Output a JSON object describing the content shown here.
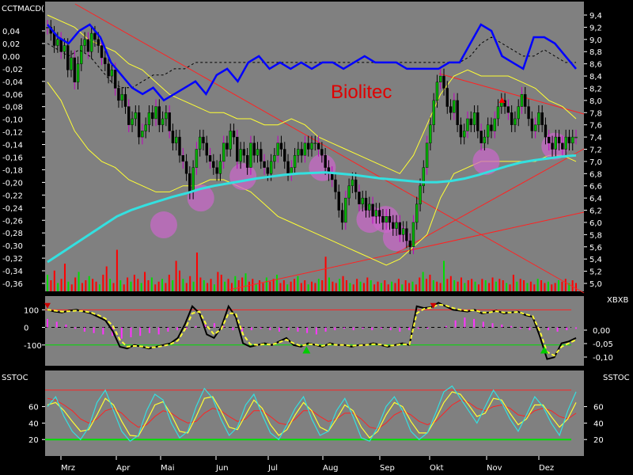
{
  "colors": {
    "background": "#000000",
    "panel": "#808080",
    "up_candle": "#00b000",
    "down_candle": "#000000",
    "wick_alt": "#c000c0",
    "blue_line": "#0000ff",
    "cyan_ma": "#33e0e0",
    "yellow": "#ffff33",
    "trendline": "#ff2222",
    "hist_magenta": "#ff33ff",
    "green_line": "#00e000",
    "vol_red": "#ff0000",
    "vol_green": "#00dd00"
  },
  "chart_data": [
    {
      "panel": "price",
      "type": "candlestick",
      "title": "Biolitec",
      "indicator_label": "CCTMACD(",
      "xlabel": "",
      "ylabel": "",
      "x_ticks": [
        "Mrz",
        "Apr",
        "Mai",
        "Jun",
        "Jul",
        "Aug",
        "Sep",
        "Okt",
        "Nov",
        "Dez"
      ],
      "y_right_range": [
        5.0,
        9.4
      ],
      "y_right_ticks": [
        "9,4",
        "9,2",
        "9,0",
        "8,8",
        "8,6",
        "8,4",
        "8,2",
        "8,0",
        "7,8",
        "7,6",
        "7,4",
        "7,2",
        "7,0",
        "6,8",
        "6,6",
        "6,4",
        "6,2",
        "6,0",
        "5,8",
        "5,6",
        "5,4",
        "5,2",
        "5,0"
      ],
      "y_left_range": [
        -0.36,
        0.04
      ],
      "y_left_ticks": [
        "0,04",
        "0,02",
        "0,00",
        "-0,02",
        "-0,04",
        "-0,06",
        "-0,08",
        "-0,10",
        "-0,12",
        "-0,14",
        "-0,16",
        "-0,18",
        "-0,20",
        "-0,22",
        "-0,24",
        "-0,26",
        "-0,28",
        "-0,30",
        "-0,32",
        "-0,34",
        "-0,36"
      ],
      "close": [
        9.2,
        9.1,
        8.9,
        9.0,
        8.8,
        8.9,
        8.5,
        8.7,
        8.3,
        8.6,
        8.9,
        9.0,
        8.8,
        9.1,
        9.0,
        8.9,
        8.7,
        8.6,
        8.4,
        8.5,
        8.2,
        8.0,
        8.1,
        7.9,
        7.6,
        7.7,
        7.8,
        7.4,
        7.5,
        7.6,
        7.8,
        7.7,
        7.9,
        7.6,
        7.7,
        7.8,
        7.5,
        7.3,
        7.4,
        7.1,
        7.0,
        6.8,
        6.5,
        6.9,
        7.2,
        7.4,
        7.3,
        7.1,
        7.0,
        6.9,
        6.8,
        7.0,
        7.3,
        7.2,
        7.5,
        7.4,
        7.0,
        7.2,
        7.1,
        6.9,
        7.3,
        7.1,
        7.2,
        7.0,
        6.9,
        6.8,
        7.0,
        7.1,
        7.3,
        7.2,
        7.0,
        6.8,
        6.9,
        7.1,
        7.2,
        7.1,
        7.3,
        7.2,
        7.3,
        7.3,
        7.2,
        7.1,
        6.9,
        6.8,
        6.7,
        6.5,
        6.2,
        6.0,
        6.4,
        6.6,
        6.7,
        6.5,
        6.3,
        6.4,
        6.2,
        6.3,
        6.1,
        6.2,
        6.1,
        6.0,
        6.1,
        6.0,
        5.9,
        6.0,
        5.8,
        5.9,
        5.7,
        5.6,
        6.0,
        6.3,
        6.6,
        6.9,
        7.3,
        7.6,
        8.0,
        8.3,
        8.4,
        8.2,
        7.9,
        7.8,
        8.0,
        7.6,
        7.4,
        7.5,
        7.7,
        7.6,
        7.8,
        7.5,
        7.3,
        7.4,
        7.6,
        7.5,
        7.7,
        7.9,
        8.0,
        7.9,
        7.8,
        7.6,
        7.7,
        7.9,
        8.1,
        7.9,
        7.7,
        7.5,
        7.6,
        7.8,
        7.6,
        7.4,
        7.3,
        7.2,
        7.4,
        7.3,
        7.2,
        7.4,
        7.3,
        7.4,
        7.4
      ],
      "volume": [
        12,
        8,
        15,
        6,
        9,
        20,
        7,
        5,
        10,
        14,
        6,
        8,
        11,
        9,
        7,
        5,
        12,
        18,
        9,
        6,
        30,
        8,
        5,
        10,
        7,
        12,
        9,
        6,
        14,
        8,
        10,
        5,
        7,
        9,
        6,
        12,
        8,
        22,
        15,
        9,
        6,
        11,
        7,
        28,
        10,
        8,
        6,
        9,
        5,
        14,
        12,
        7,
        9,
        6,
        11,
        8,
        10,
        13,
        7,
        9,
        5,
        8,
        6,
        10,
        7,
        9,
        12,
        6,
        8,
        5,
        7,
        9,
        11,
        6,
        8,
        5,
        7,
        6,
        9,
        8,
        25,
        10,
        7,
        6,
        9,
        11,
        8,
        6,
        5,
        9,
        7,
        6,
        10,
        8,
        5,
        7,
        6,
        8,
        5,
        7,
        6,
        9,
        5,
        8,
        6,
        7,
        5,
        10,
        14,
        9,
        12,
        8,
        7,
        6,
        22,
        9,
        11,
        8,
        7,
        10,
        6,
        8,
        9,
        7,
        5,
        9,
        8,
        6,
        10,
        7,
        9,
        8,
        6,
        5,
        12,
        7,
        9,
        8,
        6,
        7,
        5,
        9,
        8,
        6,
        7,
        5,
        6,
        8,
        7,
        9,
        6,
        8,
        6
      ],
      "blue_line": [
        0.05,
        0.03,
        0.02,
        0.04,
        0.05,
        0.03,
        -0.01,
        -0.03,
        -0.05,
        -0.06,
        -0.05,
        -0.07,
        -0.06,
        -0.05,
        -0.04,
        -0.06,
        -0.03,
        -0.02,
        -0.04,
        -0.01,
        0.0,
        -0.02,
        -0.01,
        -0.02,
        -0.01,
        -0.02,
        -0.01,
        -0.01,
        -0.02,
        -0.01,
        0.0,
        -0.01,
        -0.01,
        -0.01,
        -0.02,
        -0.02,
        -0.02,
        -0.02,
        -0.01,
        -0.01,
        0.02,
        0.05,
        0.04,
        0.0,
        -0.01,
        -0.02,
        0.03,
        0.03,
        0.02,
        0.0,
        -0.02
      ],
      "signal_dashed": [
        0.02,
        0.01,
        0.0,
        0.01,
        0.0,
        -0.02,
        -0.04,
        -0.05,
        -0.05,
        -0.04,
        -0.03,
        -0.03,
        -0.02,
        -0.02,
        -0.01,
        -0.01,
        -0.01,
        -0.01,
        -0.01,
        -0.01,
        -0.01,
        -0.01,
        -0.01,
        -0.01,
        -0.01,
        -0.01,
        -0.01,
        -0.01,
        -0.01,
        -0.01,
        -0.01,
        -0.01,
        -0.01,
        -0.01,
        -0.01,
        -0.01,
        -0.01,
        -0.01,
        -0.01,
        -0.01,
        0.0,
        0.02,
        0.03,
        0.02,
        0.01,
        0.0,
        0.0,
        0.01,
        0.0,
        -0.01,
        -0.01
      ],
      "cyan_ma": [
        5.35,
        5.5,
        5.65,
        5.8,
        5.95,
        6.1,
        6.2,
        6.28,
        6.35,
        6.42,
        6.48,
        6.55,
        6.6,
        6.64,
        6.68,
        6.72,
        6.75,
        6.78,
        6.8,
        6.81,
        6.82,
        6.8,
        6.78,
        6.75,
        6.72,
        6.7,
        6.68,
        6.66,
        6.66,
        6.68,
        6.72,
        6.78,
        6.85,
        6.92,
        6.98,
        7.02,
        7.05,
        7.08,
        7.1
      ],
      "upper_band": [
        9.4,
        9.3,
        9.2,
        9.0,
        8.9,
        8.8,
        8.6,
        8.5,
        8.3,
        8.1,
        8.0,
        7.9,
        7.8,
        7.8,
        7.7,
        7.7,
        7.6,
        7.6,
        7.7,
        7.6,
        7.4,
        7.3,
        7.2,
        7.1,
        7.0,
        6.9,
        6.8,
        7.1,
        7.6,
        8.1,
        8.4,
        8.5,
        8.4,
        8.4,
        8.4,
        8.3,
        8.2,
        8.0,
        7.9,
        7.7
      ],
      "lower_band": [
        8.3,
        8.0,
        7.5,
        7.2,
        7.0,
        6.9,
        6.7,
        6.6,
        6.5,
        6.5,
        6.6,
        6.6,
        6.7,
        6.7,
        6.6,
        6.5,
        6.3,
        6.1,
        6.0,
        5.9,
        5.8,
        5.7,
        5.6,
        5.5,
        5.4,
        5.3,
        5.4,
        5.6,
        5.8,
        6.4,
        6.8,
        6.9,
        7.0,
        7.0,
        7.0,
        7.0,
        7.0,
        7.1,
        7.1,
        7.0
      ],
      "circles_on_price": [
        5.96,
        6.4,
        6.75,
        6.9,
        6.05,
        6.05,
        5.75,
        7.0,
        7.25
      ],
      "arrows_on_price": [
        {
          "type": "up-triangle",
          "value": 8.0
        }
      ]
    },
    {
      "panel": "cci",
      "type": "line+histogram",
      "indicator_label": "XBXB",
      "y_left_ticks": [
        "100",
        "0",
        "-100"
      ],
      "y_left_range": [
        -200,
        160
      ],
      "y_right_ticks": [
        "0,00",
        "-0,05",
        "-0,10"
      ],
      "cci": [
        100,
        90,
        85,
        95,
        100,
        90,
        80,
        60,
        40,
        -20,
        -110,
        -120,
        -100,
        -110,
        -120,
        -110,
        -100,
        -90,
        -60,
        20,
        120,
        80,
        -40,
        -60,
        0,
        120,
        60,
        -90,
        -110,
        -100,
        -90,
        -100,
        -80,
        -60,
        -100,
        -110,
        -90,
        -100,
        -110,
        -90,
        -100,
        -100,
        -110,
        -100,
        -100,
        -90,
        -100,
        -110,
        -100,
        -90,
        -100,
        120,
        110,
        115,
        140,
        120,
        100,
        95,
        90,
        100,
        80,
        85,
        95,
        80,
        85,
        90,
        70,
        60,
        -50,
        -180,
        -170,
        -90,
        -80,
        -60
      ],
      "signal": [
        100,
        95,
        90,
        92,
        95,
        92,
        85,
        70,
        50,
        10,
        -70,
        -110,
        -105,
        -108,
        -115,
        -112,
        -105,
        -95,
        -75,
        -10,
        80,
        90,
        10,
        -40,
        -10,
        80,
        80,
        -40,
        -95,
        -100,
        -95,
        -98,
        -85,
        -70,
        -90,
        -105,
        -95,
        -98,
        -105,
        -95,
        -100,
        -100,
        -105,
        -102,
        -100,
        -95,
        -98,
        -105,
        -102,
        -95,
        -98,
        80,
        105,
        112,
        130,
        125,
        110,
        100,
        95,
        98,
        85,
        85,
        92,
        85,
        85,
        88,
        75,
        65,
        -20,
        -140,
        -160,
        -110,
        -90,
        -70
      ],
      "histogram": [
        60,
        40,
        20,
        -10,
        -30,
        -40,
        -50,
        -60,
        -80,
        -70,
        -60,
        -40,
        -50,
        -30,
        -20,
        -10,
        10,
        20,
        30,
        10,
        -20,
        -30,
        -20,
        -10,
        -20,
        -30,
        -20,
        -30,
        -40,
        -50,
        -30,
        -20,
        -10,
        -20,
        -10,
        -20,
        -10,
        -20,
        -30,
        -20,
        -10,
        -10,
        0,
        10,
        50,
        70,
        60,
        40,
        30,
        20,
        10,
        -10,
        -20,
        -10,
        -20,
        -30,
        -20,
        -10
      ],
      "markers": [
        {
          "type": "down-triangle",
          "position": "start"
        },
        {
          "type": "up-triangle",
          "position": "jul-aug"
        },
        {
          "type": "down-triangle",
          "position": "okt"
        },
        {
          "type": "up-triangle",
          "position": "dez"
        }
      ]
    },
    {
      "panel": "stochastic",
      "type": "line",
      "indicator_label": "SSTOC",
      "y_ticks": [
        "60",
        "40",
        "20"
      ],
      "y_range": [
        0,
        100
      ],
      "reference_levels": [
        20,
        80
      ],
      "fast_cyan": [
        60,
        72,
        48,
        30,
        20,
        35,
        65,
        80,
        55,
        30,
        18,
        25,
        55,
        75,
        68,
        40,
        22,
        30,
        60,
        82,
        70,
        45,
        25,
        35,
        62,
        75,
        50,
        28,
        20,
        38,
        58,
        72,
        45,
        25,
        30,
        55,
        70,
        48,
        22,
        18,
        35,
        60,
        72,
        55,
        30,
        20,
        28,
        52,
        78,
        85,
        70,
        55,
        40,
        60,
        80,
        65,
        45,
        30,
        50,
        72,
        60,
        40,
        25,
        55,
        78
      ],
      "slow_yellow": [
        62,
        65,
        55,
        42,
        30,
        32,
        50,
        70,
        62,
        42,
        25,
        24,
        42,
        62,
        66,
        50,
        30,
        28,
        48,
        70,
        72,
        55,
        35,
        32,
        50,
        68,
        58,
        38,
        25,
        32,
        50,
        65,
        55,
        35,
        30,
        45,
        62,
        55,
        35,
        22,
        30,
        50,
        65,
        60,
        42,
        28,
        28,
        45,
        65,
        78,
        75,
        62,
        48,
        52,
        70,
        68,
        52,
        38,
        45,
        62,
        62,
        48,
        35,
        45,
        65
      ],
      "slow_red": [
        70,
        68,
        62,
        55,
        45,
        40,
        45,
        55,
        58,
        52,
        42,
        35,
        38,
        48,
        55,
        52,
        45,
        40,
        42,
        52,
        58,
        55,
        48,
        42,
        45,
        55,
        55,
        48,
        40,
        38,
        45,
        55,
        55,
        48,
        42,
        45,
        52,
        52,
        45,
        35,
        33,
        40,
        50,
        55,
        50,
        42,
        38,
        42,
        52,
        62,
        68,
        65,
        58,
        55,
        60,
        62,
        58,
        50,
        48,
        55,
        58,
        55,
        48,
        45,
        52
      ]
    }
  ]
}
